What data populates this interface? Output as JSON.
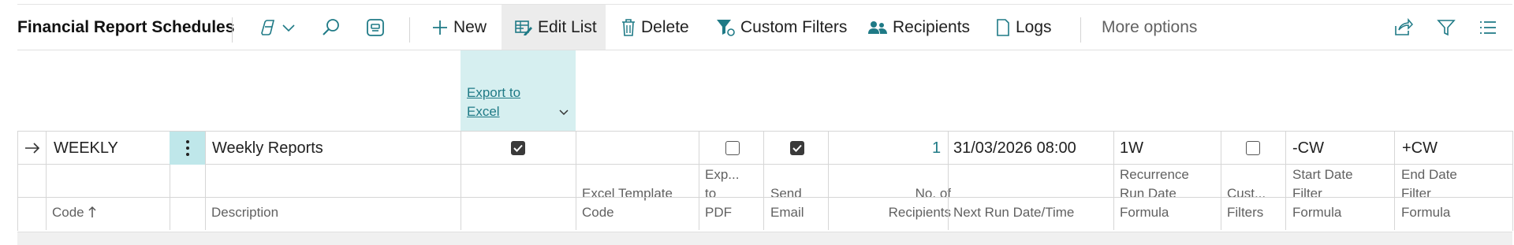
{
  "page": {
    "title": "Financial Report Schedules"
  },
  "toolbar": {
    "new": "New",
    "edit_list": "Edit List",
    "delete": "Delete",
    "custom_filters": "Custom Filters",
    "recipients": "Recipients",
    "logs": "Logs",
    "more_options": "More options"
  },
  "columns": {
    "code": "Code",
    "description": "Description",
    "export_excel_1": "Export to",
    "export_excel_2": "Excel",
    "excel_template_1": "Excel Template",
    "excel_template_2": "Code",
    "export_pdf_1": "Exp...",
    "export_pdf_2": "to",
    "export_pdf_3": "PDF",
    "send_email_1": "Send",
    "send_email_2": "Email",
    "recipients_1": "No. of",
    "recipients_2": "Recipients",
    "next_run": "Next Run Date/Time",
    "recurrence_1": "Recurrence",
    "recurrence_2": "Run Date",
    "recurrence_3": "Formula",
    "cust_filters_1": "Cust...",
    "cust_filters_2": "Filters",
    "start_filter_1": "Start Date",
    "start_filter_2": "Filter",
    "start_filter_3": "Formula",
    "end_filter_1": "End Date",
    "end_filter_2": "Filter",
    "end_filter_3": "Formula"
  },
  "rows": [
    {
      "code": "WEEKLY",
      "description": "Weekly Reports",
      "export_to_excel": true,
      "excel_template_code": "",
      "export_to_pdf": false,
      "send_email": true,
      "no_of_recipients": "1",
      "next_run": "31/03/2026 08:00",
      "recurrence": "1W",
      "custom_filters": false,
      "start_filter": "-CW",
      "end_filter": "+CW"
    }
  ],
  "colors": {
    "accent": "#1f7a86",
    "selected_header": "#d6eff0",
    "row_menu": "#bfe7ea"
  }
}
